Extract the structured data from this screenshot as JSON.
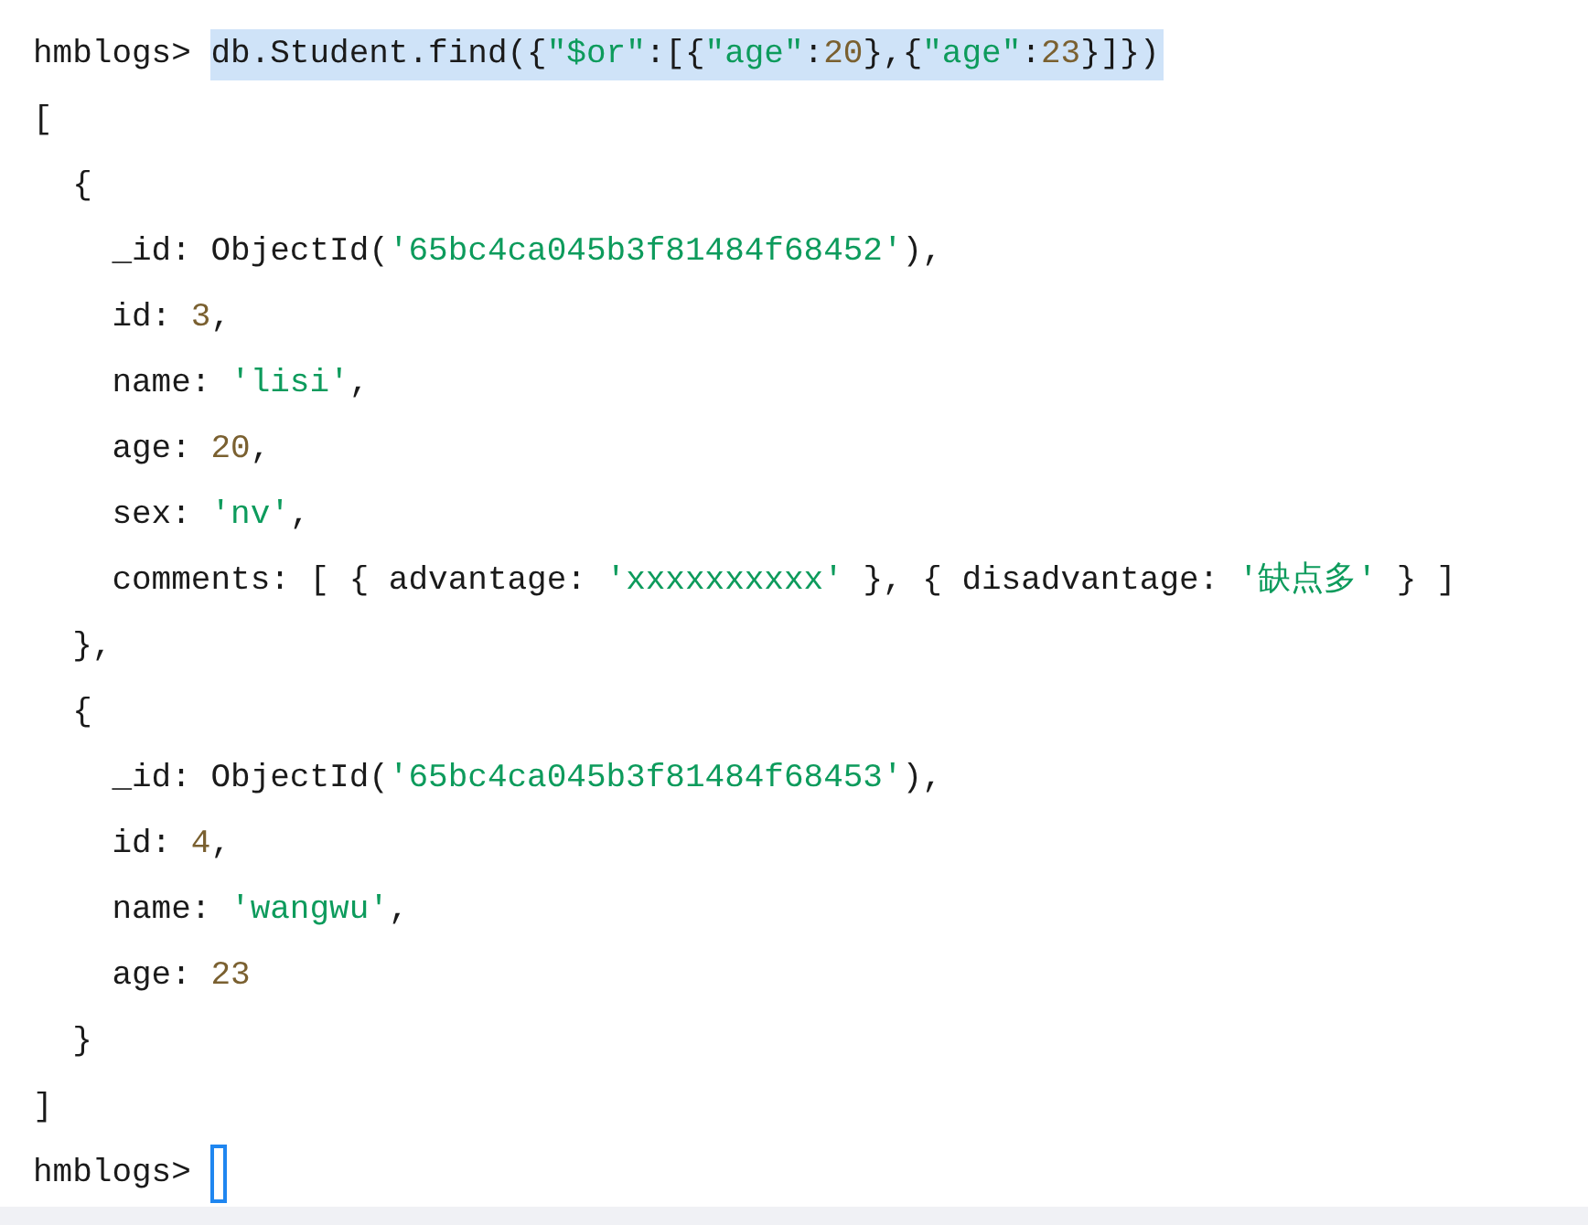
{
  "lines": [
    {
      "kind": "prompt",
      "prompt": "hmblogs>",
      "selected": true,
      "tokens": [
        {
          "kind": "plain",
          "text": "db.Student.find({"
        },
        {
          "kind": "string",
          "text": "\"$or\""
        },
        {
          "kind": "plain",
          "text": ":[{"
        },
        {
          "kind": "string",
          "text": "\"age\""
        },
        {
          "kind": "plain",
          "text": ":"
        },
        {
          "kind": "number",
          "text": "20"
        },
        {
          "kind": "plain",
          "text": "},{"
        },
        {
          "kind": "string",
          "text": "\"age\""
        },
        {
          "kind": "plain",
          "text": ":"
        },
        {
          "kind": "number",
          "text": "23"
        },
        {
          "kind": "plain",
          "text": "}]})"
        }
      ]
    },
    {
      "kind": "output",
      "tokens": [
        {
          "kind": "plain",
          "text": "["
        }
      ]
    },
    {
      "kind": "output",
      "tokens": [
        {
          "kind": "plain",
          "text": "  {"
        }
      ]
    },
    {
      "kind": "output",
      "tokens": [
        {
          "kind": "plain",
          "text": "    _id: ObjectId("
        },
        {
          "kind": "string",
          "text": "'65bc4ca045b3f81484f68452'"
        },
        {
          "kind": "plain",
          "text": "),"
        }
      ]
    },
    {
      "kind": "output",
      "tokens": [
        {
          "kind": "plain",
          "text": "    id: "
        },
        {
          "kind": "number",
          "text": "3"
        },
        {
          "kind": "plain",
          "text": ","
        }
      ]
    },
    {
      "kind": "output",
      "tokens": [
        {
          "kind": "plain",
          "text": "    name: "
        },
        {
          "kind": "string",
          "text": "'lisi'"
        },
        {
          "kind": "plain",
          "text": ","
        }
      ]
    },
    {
      "kind": "output",
      "tokens": [
        {
          "kind": "plain",
          "text": "    age: "
        },
        {
          "kind": "number",
          "text": "20"
        },
        {
          "kind": "plain",
          "text": ","
        }
      ]
    },
    {
      "kind": "output",
      "tokens": [
        {
          "kind": "plain",
          "text": "    sex: "
        },
        {
          "kind": "string",
          "text": "'nv'"
        },
        {
          "kind": "plain",
          "text": ","
        }
      ]
    },
    {
      "kind": "output",
      "tokens": [
        {
          "kind": "plain",
          "text": "    comments: [ { advantage: "
        },
        {
          "kind": "string",
          "text": "'xxxxxxxxxx'"
        },
        {
          "kind": "plain",
          "text": " }, { disadvantage: "
        },
        {
          "kind": "string",
          "text": "'缺点多'"
        },
        {
          "kind": "plain",
          "text": " } ]"
        }
      ]
    },
    {
      "kind": "output",
      "tokens": [
        {
          "kind": "plain",
          "text": "  },"
        }
      ]
    },
    {
      "kind": "output",
      "tokens": [
        {
          "kind": "plain",
          "text": "  {"
        }
      ]
    },
    {
      "kind": "output",
      "tokens": [
        {
          "kind": "plain",
          "text": "    _id: ObjectId("
        },
        {
          "kind": "string",
          "text": "'65bc4ca045b3f81484f68453'"
        },
        {
          "kind": "plain",
          "text": "),"
        }
      ]
    },
    {
      "kind": "output",
      "tokens": [
        {
          "kind": "plain",
          "text": "    id: "
        },
        {
          "kind": "number",
          "text": "4"
        },
        {
          "kind": "plain",
          "text": ","
        }
      ]
    },
    {
      "kind": "output",
      "tokens": [
        {
          "kind": "plain",
          "text": "    name: "
        },
        {
          "kind": "string",
          "text": "'wangwu'"
        },
        {
          "kind": "plain",
          "text": ","
        }
      ]
    },
    {
      "kind": "output",
      "tokens": [
        {
          "kind": "plain",
          "text": "    age: "
        },
        {
          "kind": "number",
          "text": "23"
        }
      ]
    },
    {
      "kind": "output",
      "tokens": [
        {
          "kind": "plain",
          "text": "  }"
        }
      ]
    },
    {
      "kind": "output",
      "tokens": [
        {
          "kind": "plain",
          "text": "]"
        }
      ]
    },
    {
      "kind": "prompt",
      "prompt": "hmblogs>",
      "cursor": true
    }
  ]
}
